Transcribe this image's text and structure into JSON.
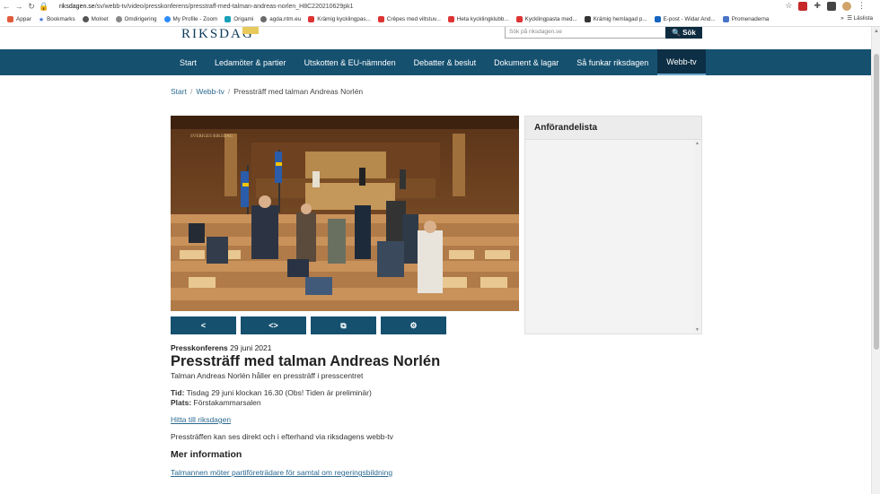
{
  "browser": {
    "url_host": "riksdagen.se",
    "url_path": "/sv/webb-tv/video/presskonferens/presstraff-med-talman-andreas-norlen_H8C220210629pk1",
    "bookmarks": [
      {
        "label": "Appar",
        "color": "#e25b3b"
      },
      {
        "label": "Bookmarks",
        "color": "#3b6fd8"
      },
      {
        "label": "Molnet",
        "color": "#555555"
      },
      {
        "label": "Omdirigering",
        "color": "#888888"
      },
      {
        "label": "My Profile - Zoom",
        "color": "#2d8cff"
      },
      {
        "label": "Origami",
        "color": "#19a0b8"
      },
      {
        "label": "agda.ntm.eu",
        "color": "#6b6b6b"
      },
      {
        "label": "Krämig kycklingpas...",
        "color": "#d33"
      },
      {
        "label": "Crêpes med viltstuv...",
        "color": "#d33"
      },
      {
        "label": "Heta kycklingklubb...",
        "color": "#d33"
      },
      {
        "label": "Kycklingpasta med...",
        "color": "#d33"
      },
      {
        "label": "Krämig hemlagad p...",
        "color": "#333"
      },
      {
        "label": "E-post - Widar And...",
        "color": "#1565c0"
      },
      {
        "label": "Promenaderna",
        "color": "#4a74c9"
      }
    ],
    "reading_list": "Läslista"
  },
  "header": {
    "logo": "RIKSDAG",
    "search_placeholder": "Sök på riksdagen.se",
    "search_button": "Sök"
  },
  "nav": [
    {
      "label": "Start"
    },
    {
      "label": "Ledamöter & partier"
    },
    {
      "label": "Utskotten & EU-nämnden"
    },
    {
      "label": "Debatter & beslut"
    },
    {
      "label": "Dokument & lagar"
    },
    {
      "label": "Så funkar riksdagen"
    },
    {
      "label": "Webb-tv"
    }
  ],
  "breadcrumb": {
    "items": [
      "Start",
      "Webb-tv",
      "Pressträff med talman Andreas Norlén"
    ],
    "sep": "/"
  },
  "video": {
    "watermark": "SVERIGES RIKSDAG"
  },
  "controls": [
    {
      "icon": "share-icon",
      "glyph": "<"
    },
    {
      "icon": "embed-icon",
      "glyph": "<>"
    },
    {
      "icon": "popout-icon",
      "glyph": "⧉"
    },
    {
      "icon": "settings-icon",
      "glyph": "⚙"
    }
  ],
  "sidebar": {
    "title": "Anförandelista"
  },
  "article": {
    "type": "Presskonferens",
    "date": "29 juni 2021",
    "title": "Pressträff med talman Andreas Norlén",
    "subtitle": "Talman Andreas Norlén håller en pressträff i presscentret",
    "tid_label": "Tid:",
    "tid_value": "Tisdag 29 juni klockan 16.30 (Obs! Tiden är preliminär)",
    "plats_label": "Plats:",
    "plats_value": "Förstakammarsalen",
    "link_find": "Hitta till riksdagen",
    "body": "Pressträffen kan ses direkt och i efterhand via riksdagens webb-tv",
    "more_heading": "Mer information",
    "more_link": "Talmannen möter partiföreträdare för samtal om regeringsbildning"
  },
  "colors": {
    "nav_bg": "#15506f",
    "nav_active": "#0d2f45",
    "link": "#2d6a91"
  }
}
